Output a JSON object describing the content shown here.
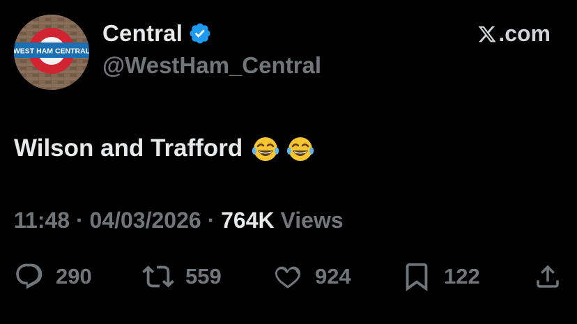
{
  "author": {
    "display_name": "Central",
    "handle": "@WestHam_Central",
    "avatar_sign_text": "WEST HAM CENTRAL",
    "verified": true
  },
  "brand": {
    "site": ".com",
    "icon": "x-logo-icon"
  },
  "tweet": {
    "text": "Wilson and Trafford",
    "emojis": [
      "face-with-tears-of-joy",
      "face-with-tears-of-joy"
    ]
  },
  "meta": {
    "time": "11:48",
    "separator": "·",
    "date": "04/03/2026",
    "views_count": "764K",
    "views_label": "Views"
  },
  "actions": {
    "replies": "290",
    "reposts": "559",
    "likes": "924",
    "bookmarks": "122"
  },
  "colors": {
    "background": "#000000",
    "primary_text": "#e7e9ea",
    "secondary_text": "#71767b",
    "verified_blue": "#1d9bf0"
  }
}
